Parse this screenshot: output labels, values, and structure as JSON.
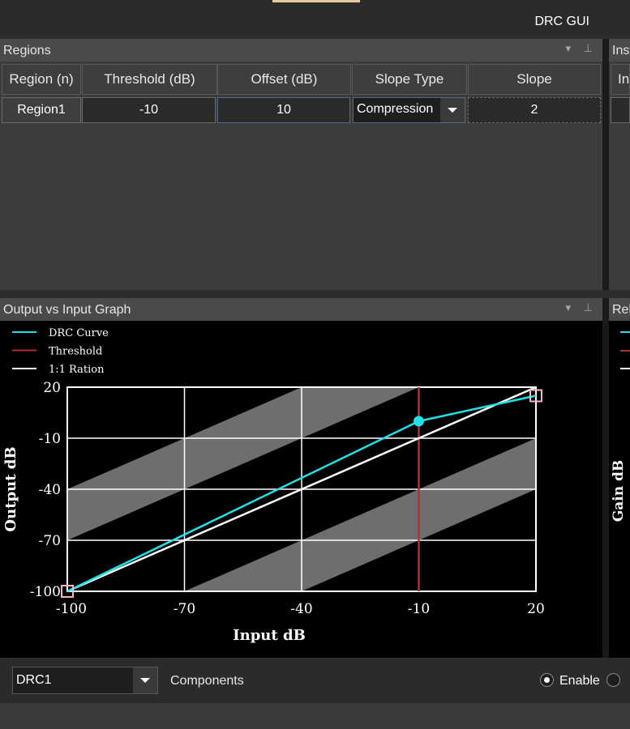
{
  "window": {
    "title": "DRC GUI"
  },
  "regions_panel": {
    "title": "Regions",
    "columns": [
      "Region (n)",
      "Threshold (dB)",
      "Offset (dB)",
      "Slope Type",
      "Slope"
    ],
    "rows": [
      {
        "region": "Region1",
        "threshold": "-10",
        "offset": "10",
        "slope_type": "Compression",
        "slope": "2"
      }
    ]
  },
  "right_panel_top": {
    "title": "Inst",
    "column": "Ins"
  },
  "graph_panel": {
    "title": "Output vs Input Graph",
    "legend": [
      {
        "label": "DRC Curve",
        "color": "#22e0e8"
      },
      {
        "label": "Threshold",
        "color": "#b03030"
      },
      {
        "label": "1:1 Ration",
        "color": "#ffffff"
      }
    ]
  },
  "right_panel_graph": {
    "title": "Rel",
    "ylabel": "Gain dB"
  },
  "chart_data": {
    "type": "line",
    "xlabel": "Input dB",
    "ylabel": "Output dB",
    "xlim": [
      -100,
      20
    ],
    "ylim": [
      -100,
      20
    ],
    "xticks": [
      "-100",
      "-70",
      "-40",
      "-10",
      "20"
    ],
    "yticks": [
      "20",
      "-10",
      "-40",
      "-70",
      "-100"
    ],
    "grid": true,
    "threshold_x": -10,
    "series": [
      {
        "name": "DRC Curve",
        "color": "#22e0e8",
        "x": [
          -100,
          -10,
          20
        ],
        "y": [
          -100,
          0,
          15
        ]
      },
      {
        "name": "1:1 Ration",
        "color": "#ffffff",
        "x": [
          -100,
          20
        ],
        "y": [
          -100,
          20
        ]
      }
    ],
    "shaded_bands": [
      {
        "from_offset": 30,
        "to_offset": 60
      },
      {
        "from_offset": -30,
        "to_offset": -60
      }
    ]
  },
  "bottom": {
    "component_select": "DRC1",
    "components_label": "Components",
    "enable_label": "Enable",
    "enable_selected": true
  }
}
